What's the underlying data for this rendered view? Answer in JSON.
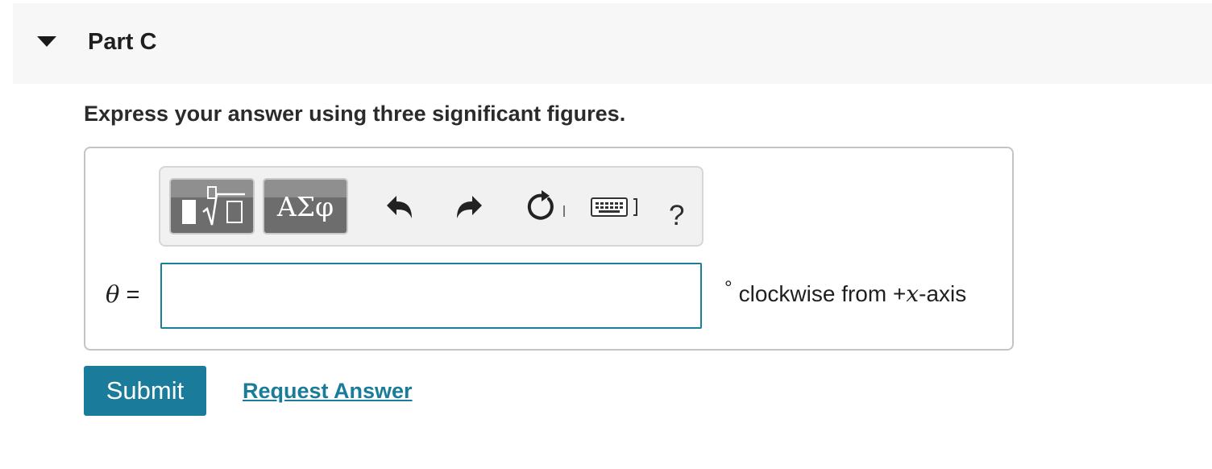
{
  "part": {
    "title": "Part C",
    "expanded": true
  },
  "instruction": "Express your answer using three significant figures.",
  "toolbar": {
    "templates_icon": "templates-icon",
    "greek_label": "ΑΣφ",
    "undo_icon": "undo-icon",
    "redo_icon": "redo-icon",
    "reset_icon": "reset-icon",
    "keyboard_icon": "keyboard-icon",
    "help_label": "?"
  },
  "answer": {
    "variable": "θ",
    "equals": "=",
    "value": "",
    "unit_degree": "°",
    "unit_text_before": "clockwise from +",
    "unit_var": "x",
    "unit_text_after": "-axis"
  },
  "actions": {
    "submit_label": "Submit",
    "request_label": "Request Answer"
  },
  "colors": {
    "accent": "#1a7b9a",
    "header_bg": "#f7f7f7",
    "toolbar_bg": "#f1f1f1",
    "button_dark": "#6d6d6d"
  }
}
